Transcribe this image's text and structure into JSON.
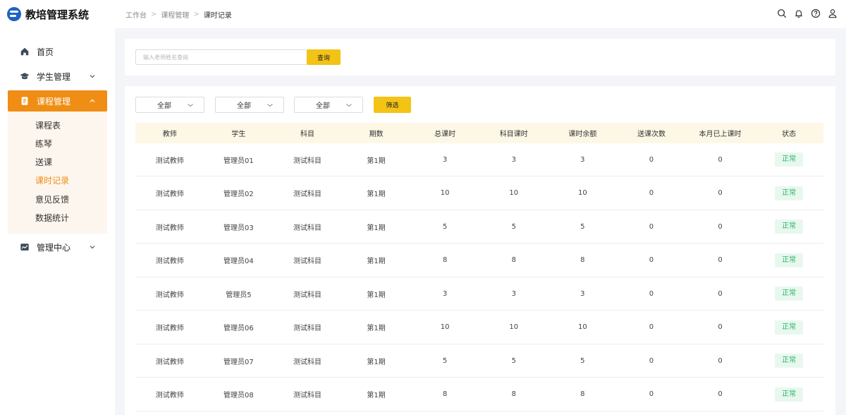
{
  "app": {
    "title": "教培管理系统"
  },
  "breadcrumb": [
    "工作台",
    "课程管理",
    "课时记录"
  ],
  "header_icons": [
    "search-icon",
    "bell-icon",
    "help-icon",
    "user-icon"
  ],
  "sidebar": {
    "items": [
      {
        "label": "首页",
        "icon": "home-icon"
      },
      {
        "label": "学生管理",
        "icon": "graduation-cap-icon"
      },
      {
        "label": "课程管理",
        "icon": "document-icon",
        "active": true
      },
      {
        "label": "管理中心",
        "icon": "dashboard-icon"
      }
    ],
    "submenu": [
      {
        "label": "课程表"
      },
      {
        "label": "练琴"
      },
      {
        "label": "送课"
      },
      {
        "label": "课时记录",
        "active": true
      },
      {
        "label": "意见反馈"
      },
      {
        "label": "数据统计"
      }
    ]
  },
  "search": {
    "placeholder": "输入老师姓名查询",
    "button": "查询"
  },
  "filters": {
    "selects": [
      "全部",
      "全部",
      "全部"
    ],
    "button": "筛选"
  },
  "table": {
    "columns": [
      "教师",
      "学生",
      "科目",
      "期数",
      "总课时",
      "科目课时",
      "课时余额",
      "送课次数",
      "本月已上课时",
      "状态"
    ],
    "rows": [
      [
        "测试教师",
        "管理员01",
        "测试科目",
        "第1期",
        "3",
        "3",
        "3",
        "0",
        "0",
        "正常"
      ],
      [
        "测试教师",
        "管理员02",
        "测试科目",
        "第1期",
        "10",
        "10",
        "10",
        "0",
        "0",
        "正常"
      ],
      [
        "测试教师",
        "管理员03",
        "测试科目",
        "第1期",
        "5",
        "5",
        "5",
        "0",
        "0",
        "正常"
      ],
      [
        "测试教师",
        "管理员04",
        "测试科目",
        "第1期",
        "8",
        "8",
        "8",
        "0",
        "0",
        "正常"
      ],
      [
        "测试教师",
        "管理员5",
        "测试科目",
        "第1期",
        "3",
        "3",
        "3",
        "0",
        "0",
        "正常"
      ],
      [
        "测试教师",
        "管理员06",
        "测试科目",
        "第1期",
        "10",
        "10",
        "10",
        "0",
        "0",
        "正常"
      ],
      [
        "测试教师",
        "管理员07",
        "测试科目",
        "第1期",
        "5",
        "5",
        "5",
        "0",
        "0",
        "正常"
      ],
      [
        "测试教师",
        "管理员08",
        "测试科目",
        "第1期",
        "8",
        "8",
        "8",
        "0",
        "0",
        "正常"
      ]
    ]
  },
  "colors": {
    "accent": "#ef8d14",
    "button": "#f3c316",
    "status_ok": "#2bb56a",
    "brand": "#1e63c4"
  }
}
